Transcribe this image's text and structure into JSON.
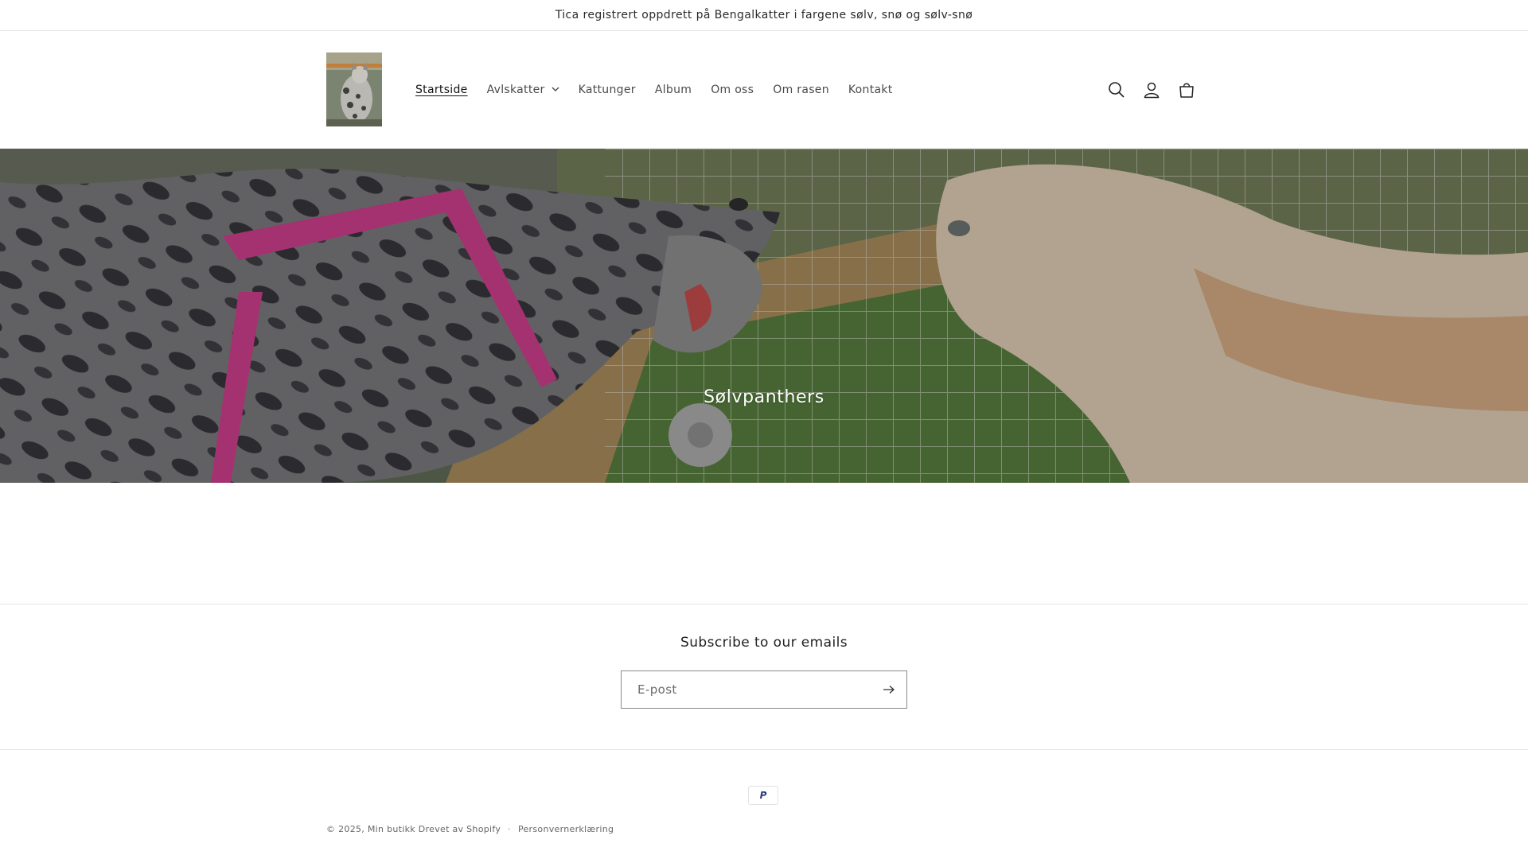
{
  "announcement": {
    "text": "Tica registrert oppdrett på Bengalkatter i fargene sølv, snø og sølv-snø"
  },
  "header": {
    "logo_icon": "cat-photo-logo",
    "nav": [
      {
        "label": "Startside",
        "active": true
      },
      {
        "label": "Avlskatter",
        "has_dropdown": true
      },
      {
        "label": "Kattunger"
      },
      {
        "label": "Album"
      },
      {
        "label": "Om oss"
      },
      {
        "label": "Om rasen"
      },
      {
        "label": "Kontakt"
      }
    ],
    "icons": [
      "search-icon",
      "account-icon",
      "cart-icon"
    ]
  },
  "hero": {
    "title": "Sølvpanthers",
    "image": "two-cats-through-wire-fence"
  },
  "newsletter": {
    "title": "Subscribe to our emails",
    "email_placeholder": "E-post",
    "submit_icon": "arrow-right-icon"
  },
  "footer": {
    "payment_icon": "paypal-icon",
    "payment_label": "P",
    "copyright": "© 2025,",
    "shop_name": "Min butikk",
    "powered_by": "Drevet av Shopify",
    "separator": "·",
    "privacy": "Personvernerklæring"
  },
  "colors": {
    "accent": "#121212",
    "border": "#e6e6e6",
    "paypal": "#253b80"
  }
}
